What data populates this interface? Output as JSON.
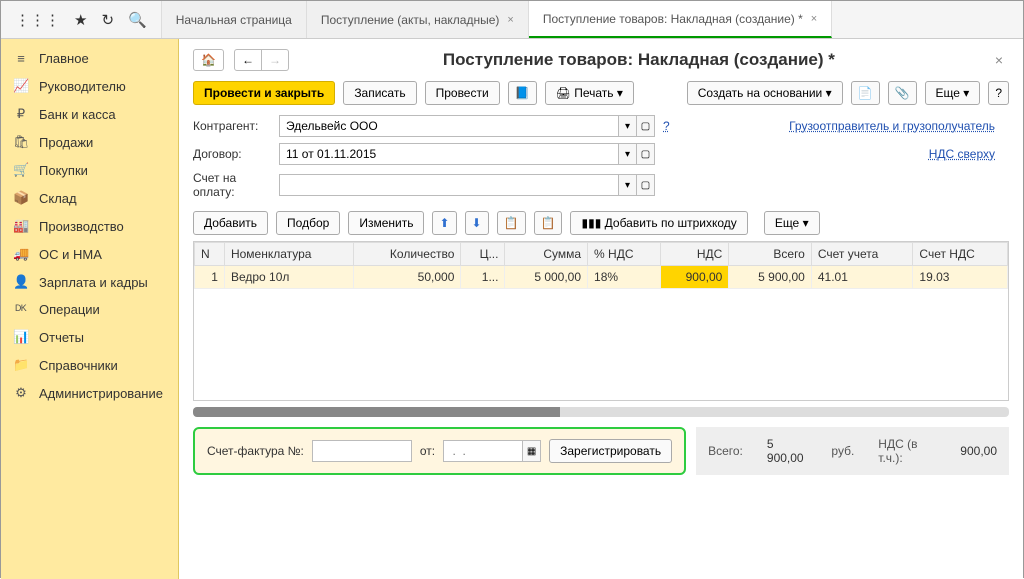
{
  "tabs": [
    {
      "label": "Начальная страница"
    },
    {
      "label": "Поступление (акты, накладные)"
    },
    {
      "label": "Поступление товаров: Накладная (создание) *",
      "active": true
    }
  ],
  "sidebar": {
    "items": [
      {
        "icon": "≡",
        "label": "Главное"
      },
      {
        "icon": "📈",
        "label": "Руководителю"
      },
      {
        "icon": "₽",
        "label": "Банк и касса"
      },
      {
        "icon": "🛍",
        "label": "Продажи"
      },
      {
        "icon": "🛒",
        "label": "Покупки"
      },
      {
        "icon": "📦",
        "label": "Склад"
      },
      {
        "icon": "🏭",
        "label": "Производство"
      },
      {
        "icon": "🚚",
        "label": "ОС и НМА"
      },
      {
        "icon": "👤",
        "label": "Зарплата и кадры"
      },
      {
        "icon": "ᴰᴷ",
        "label": "Операции"
      },
      {
        "icon": "📊",
        "label": "Отчеты"
      },
      {
        "icon": "📁",
        "label": "Справочники"
      },
      {
        "icon": "⚙",
        "label": "Администрирование"
      }
    ]
  },
  "page": {
    "title": "Поступление товаров: Накладная (создание) *"
  },
  "toolbar": {
    "primary": "Провести и закрыть",
    "write": "Записать",
    "post": "Провести",
    "print": "Печать ▾",
    "create_based": "Создать на основании ▾",
    "more": "Еще ▾",
    "help": "?"
  },
  "form": {
    "contractor_label": "Контрагент:",
    "contractor_value": "Эдельвейс ООО",
    "contract_label": "Договор:",
    "contract_value": "11 от 01.11.2015",
    "invoice_for_label": "Счет на оплату:",
    "invoice_for_value": "",
    "shipper_link": "Грузоотправитель и грузополучатель",
    "vat_link": "НДС сверху",
    "help": "?"
  },
  "toolbar2": {
    "add": "Добавить",
    "pick": "Подбор",
    "edit": "Изменить",
    "barcode": "Добавить по штрихкоду",
    "more": "Еще ▾"
  },
  "table": {
    "headers": [
      "N",
      "Номенклатура",
      "Количество",
      "Ц...",
      "Сумма",
      "% НДС",
      "НДС",
      "Всего",
      "Счет учета",
      "Счет НДС"
    ],
    "rows": [
      {
        "n": "1",
        "nom": "Ведро 10л",
        "qty": "50,000",
        "price": "1...",
        "sum": "5 000,00",
        "vat_pct": "18%",
        "vat": "900,00",
        "total": "5 900,00",
        "acc": "41.01",
        "vat_acc": "19.03"
      }
    ]
  },
  "invoice": {
    "label": "Счет-фактура №:",
    "from_label": "от:",
    "date_placeholder": " .  .    ",
    "register": "Зарегистрировать"
  },
  "totals": {
    "total_label": "Всего:",
    "total_value": "5 900,00",
    "currency": "руб.",
    "vat_label": "НДС (в т.ч.):",
    "vat_value": "900,00"
  }
}
